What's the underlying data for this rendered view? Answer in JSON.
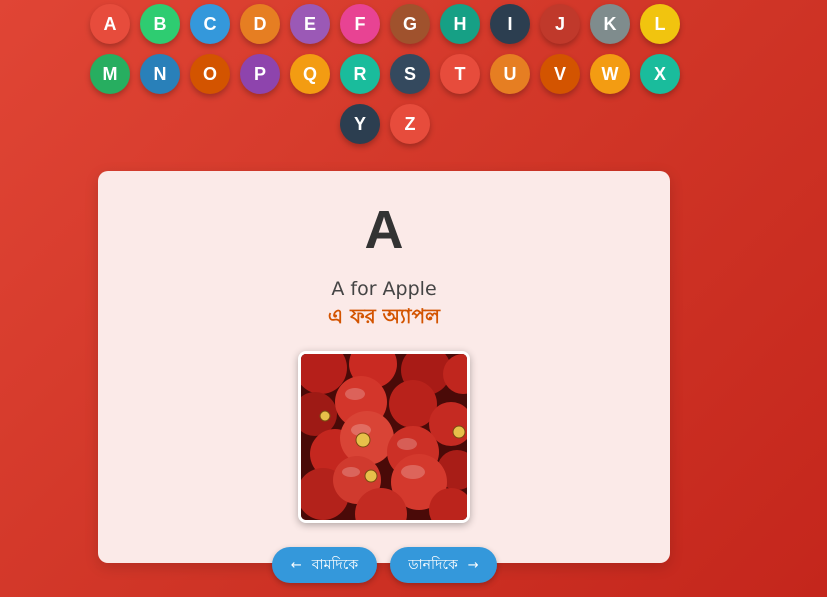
{
  "letters": [
    {
      "label": "A",
      "color": "#e74c3c"
    },
    {
      "label": "B",
      "color": "#2ecc71"
    },
    {
      "label": "C",
      "color": "#3498db"
    },
    {
      "label": "D",
      "color": "#e67e22"
    },
    {
      "label": "E",
      "color": "#9b59b6"
    },
    {
      "label": "F",
      "color": "#e84393"
    },
    {
      "label": "G",
      "color": "#a0522d"
    },
    {
      "label": "H",
      "color": "#16a085"
    },
    {
      "label": "I",
      "color": "#2c3e50"
    },
    {
      "label": "J",
      "color": "#c0392b"
    },
    {
      "label": "K",
      "color": "#7f8c8d"
    },
    {
      "label": "L",
      "color": "#f1c40f"
    },
    {
      "label": "M",
      "color": "#27ae60"
    },
    {
      "label": "N",
      "color": "#2980b9"
    },
    {
      "label": "O",
      "color": "#d35400"
    },
    {
      "label": "P",
      "color": "#8e44ad"
    },
    {
      "label": "Q",
      "color": "#f39c12"
    },
    {
      "label": "R",
      "color": "#1abc9c"
    },
    {
      "label": "S",
      "color": "#34495e"
    },
    {
      "label": "T",
      "color": "#e74c3c"
    },
    {
      "label": "U",
      "color": "#e67e22"
    },
    {
      "label": "V",
      "color": "#d35400"
    },
    {
      "label": "W",
      "color": "#f39c12"
    },
    {
      "label": "X",
      "color": "#1abc9c"
    },
    {
      "label": "Y",
      "color": "#2c3e50"
    },
    {
      "label": "Z",
      "color": "#e74c3c"
    }
  ],
  "card": {
    "letter": "A",
    "word_en": "A for Apple",
    "word_bn": "এ ফর অ্যাপল",
    "image_icon": "apples-photo"
  },
  "nav": {
    "prev_label": "বামদিকে",
    "prev_arrow": "←",
    "next_label": "ডানদিকে",
    "next_arrow": "→"
  },
  "colors": {
    "background": "#cf3426",
    "card_bg": "#fbeae8",
    "bengali_text": "#d35400",
    "nav_button": "#3498db"
  }
}
